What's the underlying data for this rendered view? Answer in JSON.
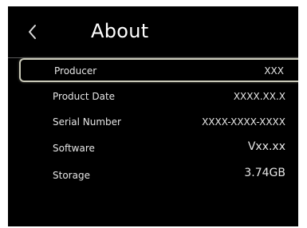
{
  "header": {
    "back_icon": "chevron-left-icon",
    "title": "About"
  },
  "items": [
    {
      "label": "Producer",
      "value": "XXX"
    },
    {
      "label": "Product Date",
      "value": "XXXX.XX.X"
    },
    {
      "label": "Serial Number",
      "value": "XXXX-XXXX-XXXX"
    },
    {
      "label": "Software",
      "value": "Vxx.xx"
    },
    {
      "label": "Storage",
      "value": "3.74GB"
    }
  ],
  "colors": {
    "background": "#000000",
    "text": "#e6e6e6",
    "selection_border": "#c9c9b8",
    "divider": "#5a5a5a"
  }
}
